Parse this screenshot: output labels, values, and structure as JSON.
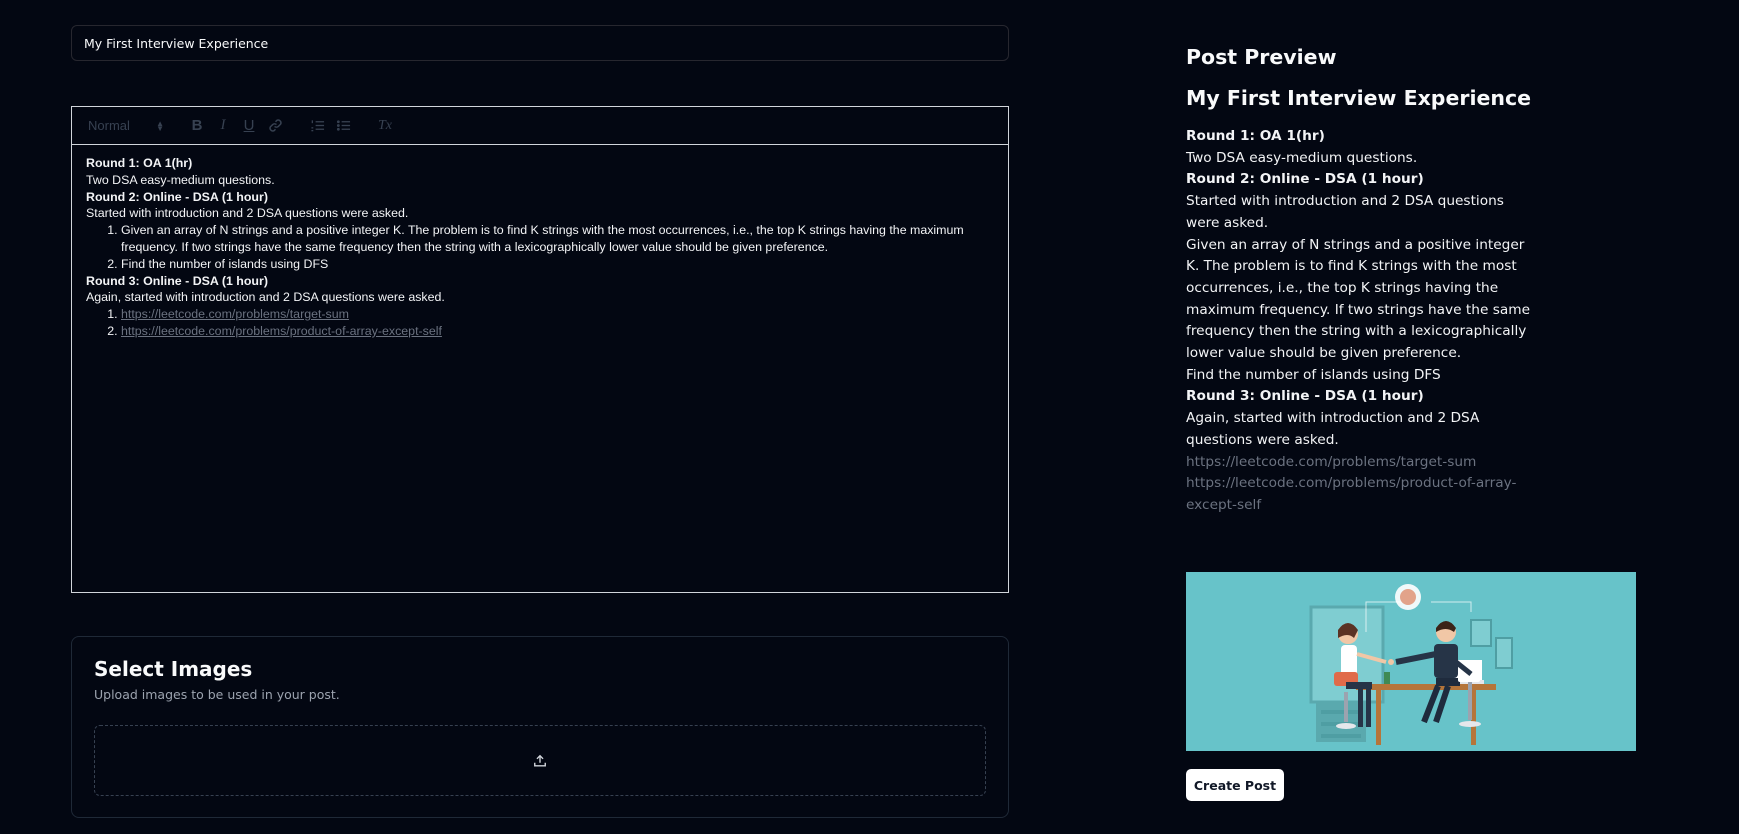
{
  "title_input": {
    "value": "My First Interview Experience"
  },
  "toolbar": {
    "heading_select": "Normal",
    "bold": "B",
    "italic": "I",
    "underline": "U",
    "clear": "Tx"
  },
  "content": {
    "r1_title": "Round 1: OA 1(hr)",
    "r1_text": "Two DSA easy-medium questions.",
    "r2_title": "Round 2: Online - DSA (1 hour)",
    "r2_text": "Started with introduction and 2 DSA questions were asked.",
    "r2_q1": "Given an array of N strings and a positive integer K. The problem is to find K strings with the most occurrences, i.e., the top K strings having the maximum frequency. If two strings have the same frequency then the string with a lexicographically lower value should be given preference.",
    "r2_q2": "Find the number of islands using DFS",
    "r3_title": "Round 3: Online - DSA (1 hour)",
    "r3_text": "Again, started with introduction and 2 DSA questions were asked.",
    "link1": "https://leetcode.com/problems/target-sum",
    "link2": "https://leetcode.com/problems/product-of-array-except-self"
  },
  "images": {
    "title": "Select Images",
    "subtitle": "Upload images to be used in your post."
  },
  "preview": {
    "heading": "Post Preview",
    "title": "My First Interview Experience"
  },
  "create_button": "Create Post",
  "colors": {
    "background": "#030712",
    "border": "#1f2937",
    "link": "#6b7280",
    "image_bg": "#67c3c9"
  }
}
